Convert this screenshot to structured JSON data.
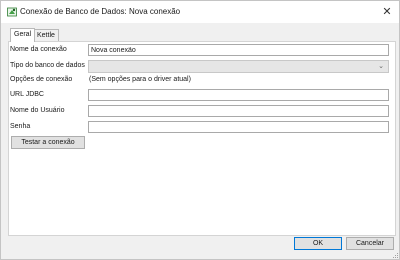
{
  "window": {
    "title": "Conexão de Banco de Dados: Nova conexão",
    "close_icon": "close-icon",
    "app_icon": "database-connection-icon"
  },
  "tabs": [
    {
      "label": "Geral",
      "selected": true
    },
    {
      "label": "Kettle",
      "selected": false
    }
  ],
  "form": {
    "connection_name": {
      "label": "Nome da conexão",
      "value": "Nova conexão"
    },
    "database_type": {
      "label": "Tipo do banco de dados",
      "value": ""
    },
    "connection_options": {
      "label": "Opções de conexão",
      "value": "(Sem opções para o driver atual)"
    },
    "jdbc_url": {
      "label": "URL JDBC",
      "value": ""
    },
    "username": {
      "label": "Nome do Usuário",
      "value": ""
    },
    "password": {
      "label": "Senha",
      "value": ""
    }
  },
  "buttons": {
    "test": "Testar a conexão",
    "ok": "OK",
    "cancel": "Cancelar"
  }
}
